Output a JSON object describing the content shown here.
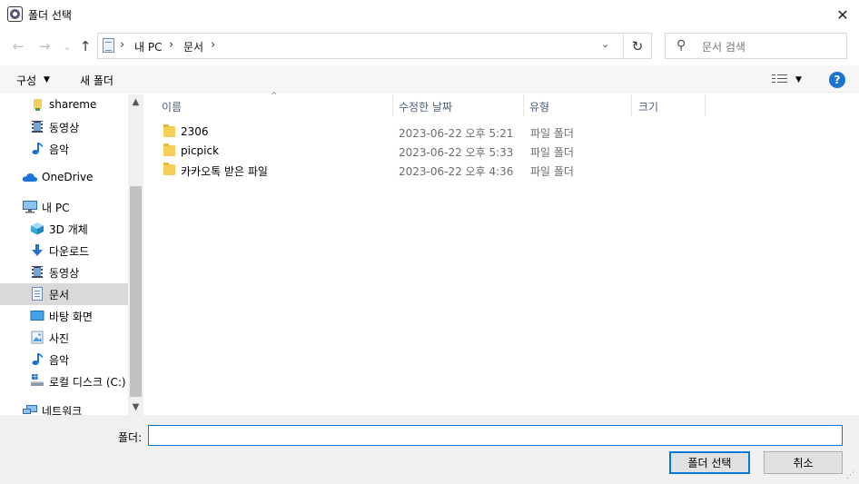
{
  "window": {
    "title": "폴더 선택",
    "close_glyph": "✕"
  },
  "nav": {
    "back_glyph": "←",
    "forward_glyph": "→",
    "recent_glyph": "⌄",
    "up_glyph": "↑",
    "breadcrumbs": [
      "내 PC",
      "문서"
    ],
    "separator": "›",
    "dropdown_glyph": "⌄",
    "refresh_glyph": "↻",
    "search_icon": "⚲",
    "search_placeholder": "문서 검색"
  },
  "toolbar": {
    "organize_label": "구성",
    "caret": "▼",
    "new_folder_label": "새 폴더",
    "help_label": "?"
  },
  "sidebar": {
    "items": [
      {
        "label": "shareme",
        "icon": "folder-icon"
      },
      {
        "label": "동영상",
        "icon": "film-icon"
      },
      {
        "label": "음악",
        "icon": "music-note-icon"
      },
      {
        "label": "OneDrive",
        "icon": "cloud-icon"
      },
      {
        "label": "내 PC",
        "icon": "computer-icon"
      },
      {
        "label": "3D 개체",
        "icon": "cube-icon"
      },
      {
        "label": "다운로드",
        "icon": "download-arrow-icon"
      },
      {
        "label": "동영상",
        "icon": "film-icon"
      },
      {
        "label": "문서",
        "icon": "document-icon",
        "selected": true
      },
      {
        "label": "바탕 화면",
        "icon": "desktop-icon"
      },
      {
        "label": "사진",
        "icon": "picture-icon"
      },
      {
        "label": "음악",
        "icon": "music-note-icon"
      },
      {
        "label": "로컬 디스크 (C:)",
        "icon": "drive-icon"
      },
      {
        "label": "네트워크",
        "icon": "network-icon"
      }
    ],
    "scroll_up": "▲",
    "scroll_down": "▼"
  },
  "filelist": {
    "sort_indicator": "^",
    "columns": [
      "이름",
      "수정한 날짜",
      "유형",
      "크기"
    ],
    "rows": [
      {
        "name": "2306",
        "date": "2023-06-22 오후 5:21",
        "type": "파일 폴더"
      },
      {
        "name": "picpick",
        "date": "2023-06-22 오후 5:33",
        "type": "파일 폴더"
      },
      {
        "name": "카카오톡 받은 파일",
        "date": "2023-06-22 오후 4:36",
        "type": "파일 폴더"
      }
    ]
  },
  "bottom": {
    "folder_label": "폴더:",
    "folder_value": "",
    "select_label": "폴더 선택",
    "cancel_label": "취소",
    "grip": "⋰"
  },
  "colors": {
    "accent": "#0078d7",
    "selected_bg": "#d9d9d9",
    "folder": "#f6cf5b",
    "help": "#1a73d3"
  }
}
